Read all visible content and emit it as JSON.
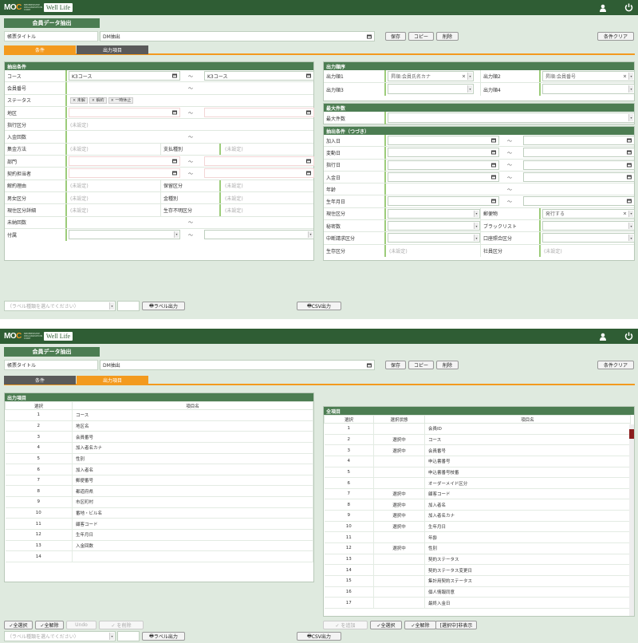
{
  "brand": {
    "moc": "MOC",
    "sub": "MEMBERSHIP ORGANIZATION CORE",
    "wl": "Well Life"
  },
  "title": "会員データ抽出",
  "title_label": "帳票タイトル",
  "title_value": "DM抽出",
  "buttons": {
    "save": "保存",
    "copy": "コピー",
    "delete": "削除",
    "clear": "条件クリア",
    "label_out": "ラベル出力",
    "csv_out": "CSV出力"
  },
  "tabs": {
    "cond": "条件",
    "out": "出力項目"
  },
  "label_type_placeholder": "（ラベル種類を選んでください）",
  "unset": "(未設定)",
  "tilde": "〜",
  "left": {
    "header": "抽出条件",
    "course": "コース",
    "course_from": "K3コース",
    "course_to": "K3コース",
    "member_no": "会員番号",
    "status": "ステータス",
    "status_chips": [
      "× 未解",
      "× 解約",
      "× 一時休止"
    ],
    "area": "地区",
    "pay_cat": "指行区分",
    "deposit_count": "入金回数",
    "collect": "集金方法",
    "pay_class": "支払種別",
    "dept": "部門",
    "contract_person": "契約担当者",
    "cancel_reason": "解約理由",
    "maint": "保留区分",
    "gender": "男女区分",
    "amount": "金種別",
    "status_detail": "現住区分詳細",
    "unknown": "生存不明区分",
    "unpaid": "未納回数",
    "extra": "付属"
  },
  "right": {
    "order_header": "出力順序",
    "order1": "出力順1",
    "order1_val": "昇順:会員氏名カナ",
    "order2": "出力順2",
    "order2_val": "昇順:会員番号",
    "order3": "出力順3",
    "order4": "出力順4",
    "max_header": "最大件数",
    "max_label": "最大件数",
    "cont_header": "抽出条件（つづき）",
    "join_date": "加入日",
    "change_date": "変動日",
    "pay_date": "指行日",
    "deposit_date": "入金日",
    "age": "年齢",
    "birth": "生年月日",
    "residence": "現住区分",
    "mail": "郵便物",
    "mail_val": "発行する",
    "secret": "秘密数",
    "blacklist": "ブラックリスト",
    "claim": "中断請求区分",
    "account": "口座照合区分",
    "alive": "生存区分",
    "staff": "社員区分"
  },
  "bottom": {
    "out_header": "出力項目",
    "all_header": "全項目",
    "col_sel": "選択",
    "col_name": "項目名",
    "col_state": "選択状態",
    "out_items": [
      [
        "1",
        "コース"
      ],
      [
        "2",
        "地区名"
      ],
      [
        "3",
        "会員番号"
      ],
      [
        "4",
        "加入者名カナ"
      ],
      [
        "5",
        "性別"
      ],
      [
        "6",
        "加入者名"
      ],
      [
        "7",
        "郵便番号"
      ],
      [
        "8",
        "都道府県"
      ],
      [
        "9",
        "市区町村"
      ],
      [
        "10",
        "番地・ビル名"
      ],
      [
        "11",
        "顧客コード"
      ],
      [
        "12",
        "生年月日"
      ],
      [
        "13",
        "入金回数"
      ],
      [
        "14",
        ""
      ]
    ],
    "all_items": [
      [
        "1",
        "",
        "会員ID"
      ],
      [
        "2",
        "選択中",
        "コース"
      ],
      [
        "3",
        "選択中",
        "会員番号"
      ],
      [
        "4",
        "",
        "申込書番号"
      ],
      [
        "5",
        "",
        "申込書番号枝番"
      ],
      [
        "6",
        "",
        "オーダーメイド区分"
      ],
      [
        "7",
        "選択中",
        "顧客コード"
      ],
      [
        "8",
        "選択中",
        "加入者名"
      ],
      [
        "9",
        "選択中",
        "加入者名カナ"
      ],
      [
        "10",
        "選択中",
        "生年月日"
      ],
      [
        "11",
        "",
        "年齢"
      ],
      [
        "12",
        "選択中",
        "性別"
      ],
      [
        "13",
        "",
        "契約ステータス"
      ],
      [
        "14",
        "",
        "契約ステータス変更日"
      ],
      [
        "15",
        "",
        "集計用契約ステータス"
      ],
      [
        "16",
        "",
        "個人情報同意"
      ],
      [
        "17",
        "",
        "最終入金日"
      ]
    ],
    "btns_left": [
      "✓全選択",
      "✓全解除",
      "Undo",
      "✓ を削除"
    ],
    "btns_right": [
      "✓ を追加",
      "✓全選択",
      "✓全解除",
      "[選択中]非表示"
    ]
  }
}
